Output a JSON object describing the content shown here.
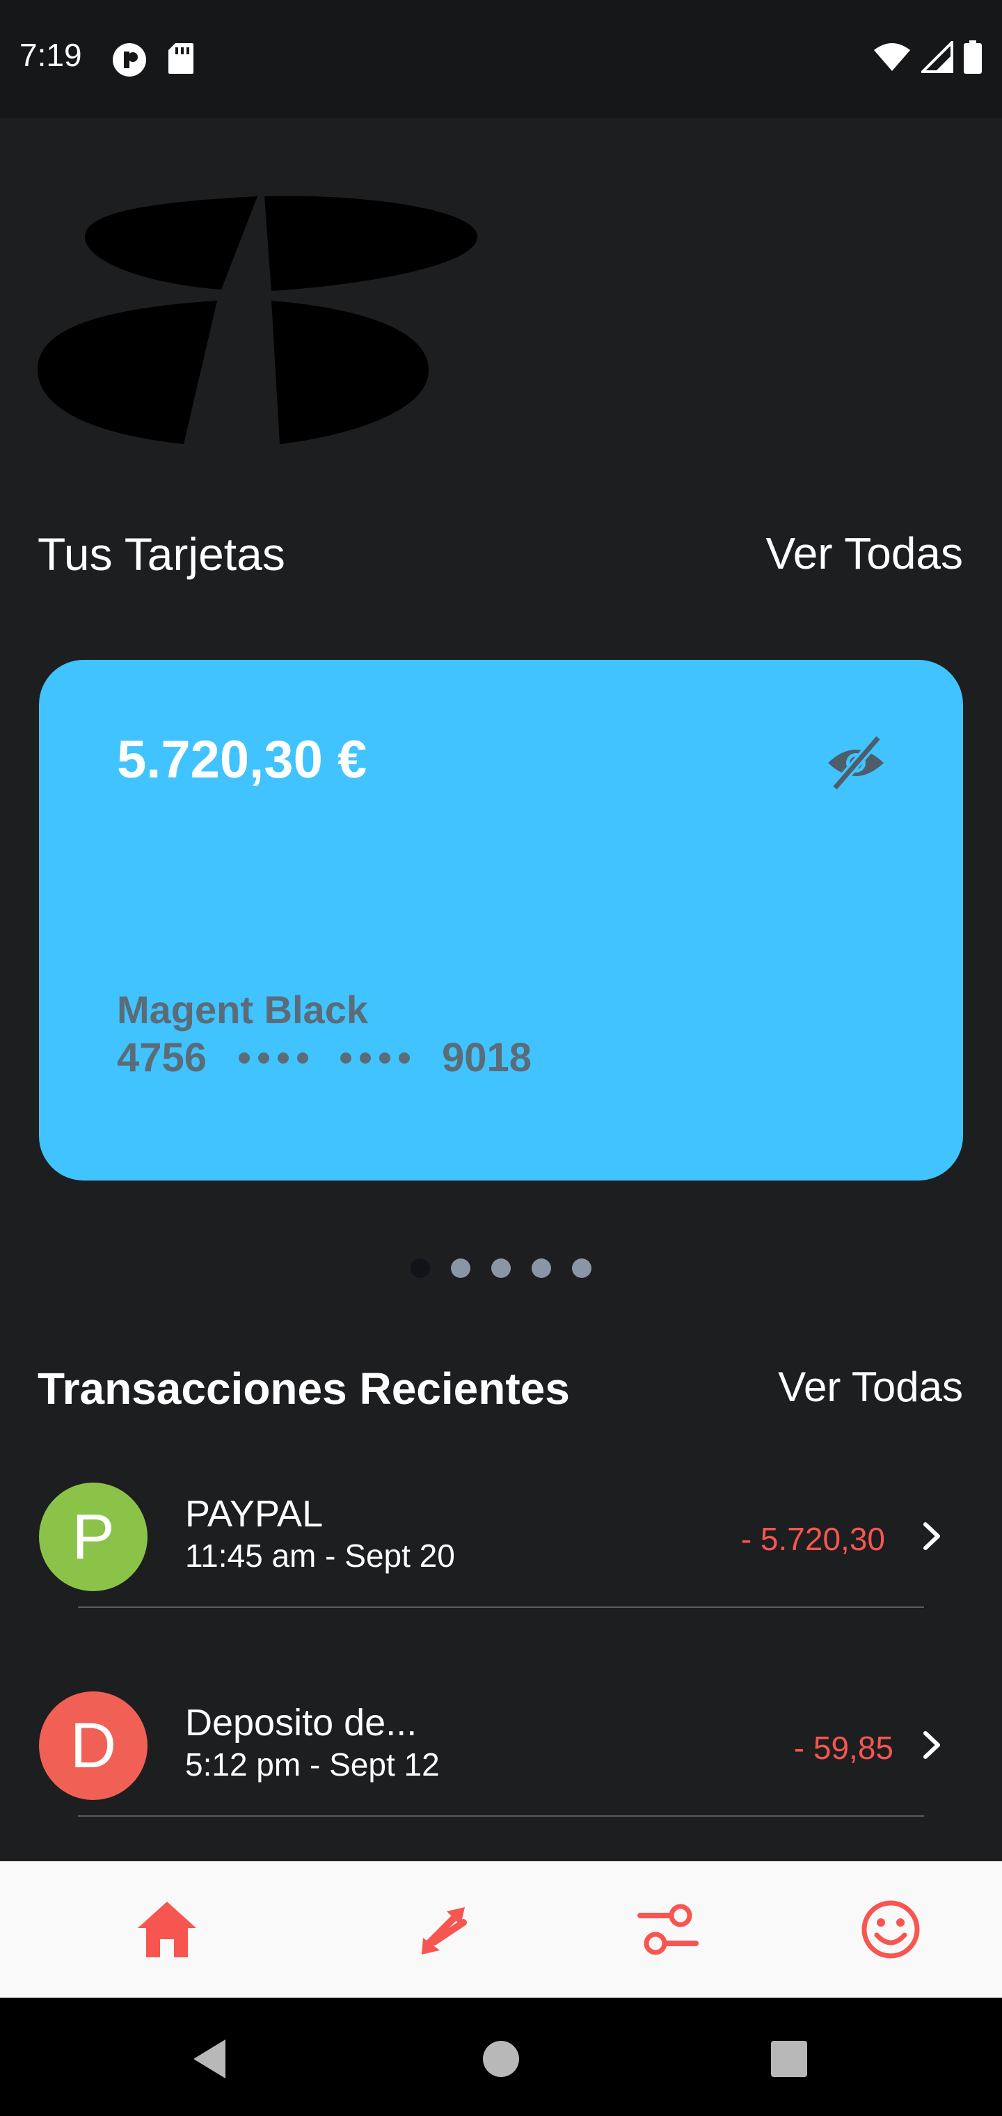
{
  "status_bar": {
    "time": "7:19"
  },
  "colors": {
    "background": "#1d1e20",
    "card": "#40c3fe",
    "accent_red": "#f75550",
    "paypal_avatar": "#8bc349",
    "deposit_avatar": "#f06055"
  },
  "cards_section": {
    "title": "Tus Tarjetas",
    "view_all": "Ver Todas",
    "card": {
      "balance": "5.720,30 €",
      "name": "Magent Black",
      "number_start": "4756",
      "number_end": "9018"
    },
    "pager": {
      "count": 5,
      "active_index": 0
    }
  },
  "transactions_section": {
    "title": "Transacciones Recientes",
    "view_all": "Ver Todas",
    "items": [
      {
        "initial": "P",
        "name": "PAYPAL",
        "time": "11:45 am - Sept 20",
        "amount": "- 5.720,30"
      },
      {
        "initial": "D",
        "name": "Deposito de...",
        "time": "5:12 pm - Sept 12",
        "amount": "- 59,85"
      }
    ]
  },
  "bottom_nav": {
    "items": [
      {
        "icon": "home-icon"
      },
      {
        "icon": "transfer-icon"
      },
      {
        "icon": "settings-sliders-icon"
      },
      {
        "icon": "smile-icon"
      }
    ]
  },
  "icons": {
    "status_left": [
      "data-saver-icon",
      "sd-card-icon"
    ],
    "status_right": [
      "wifi-icon",
      "signal-icon",
      "battery-icon"
    ],
    "card": "eye-off-icon",
    "row": "chevron-right-icon",
    "system_nav": [
      "back-icon",
      "home-circle-icon",
      "recents-icon"
    ]
  }
}
